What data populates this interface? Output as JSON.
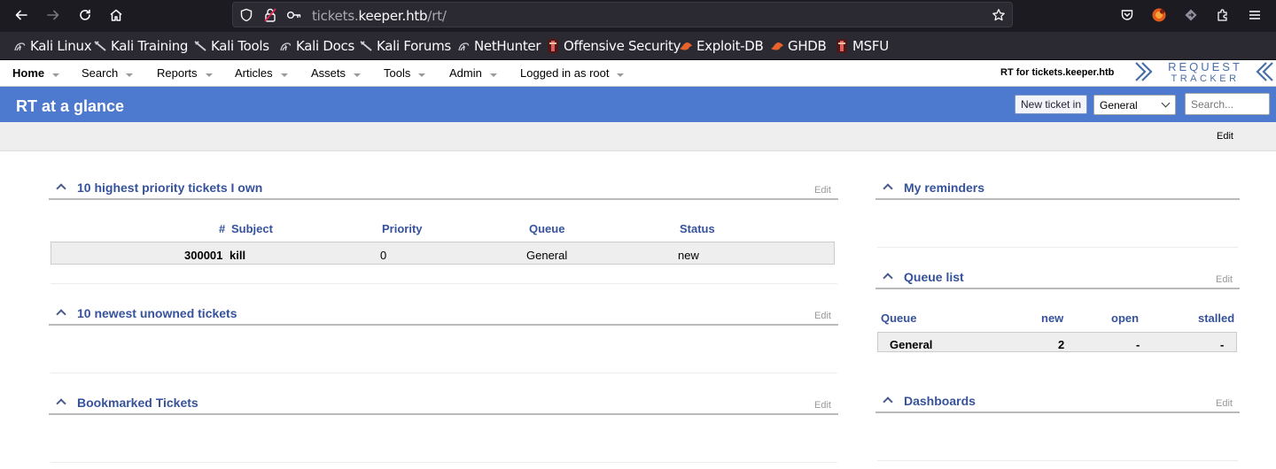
{
  "browser": {
    "url_prefix": "tickets.",
    "url_host": "keeper.htb",
    "url_path": "/rt/"
  },
  "bookmarks": [
    {
      "label": "Kali Linux",
      "icon": "kali-dragon-icon"
    },
    {
      "label": "Kali Training",
      "icon": "kali-sword-icon"
    },
    {
      "label": "Kali Tools",
      "icon": "kali-sword-icon"
    },
    {
      "label": "Kali Docs",
      "icon": "kali-dragon-icon"
    },
    {
      "label": "Kali Forums",
      "icon": "kali-sword-icon"
    },
    {
      "label": "NetHunter",
      "icon": "kali-dragon-icon"
    },
    {
      "label": "Offensive Security",
      "icon": "offsec-icon"
    },
    {
      "label": "Exploit-DB",
      "icon": "exploitdb-icon"
    },
    {
      "label": "GHDB",
      "icon": "exploitdb-icon"
    },
    {
      "label": "MSFU",
      "icon": "offsec-icon"
    }
  ],
  "menu": {
    "items": [
      "Home",
      "Search",
      "Reports",
      "Articles",
      "Assets",
      "Tools",
      "Admin",
      "Logged in as root"
    ],
    "rt_for": "RT for tickets.keeper.htb",
    "logo_line1": "REQUEST",
    "logo_line2": "TRACKER"
  },
  "header": {
    "title": "RT at a glance",
    "new_ticket_label": "New ticket in",
    "queue_selected": "General",
    "search_placeholder": "Search..."
  },
  "subbar": {
    "edit_label": "Edit"
  },
  "portlets": {
    "highest_priority": {
      "title": "10 highest priority tickets I own",
      "edit": "Edit",
      "columns": {
        "id": "#",
        "subject": "Subject",
        "priority": "Priority",
        "queue": "Queue",
        "status": "Status"
      },
      "rows": [
        {
          "id": "300001",
          "subject": "kill",
          "priority": "0",
          "queue": "General",
          "status": "new"
        }
      ]
    },
    "newest_unowned": {
      "title": "10 newest unowned tickets",
      "edit": "Edit"
    },
    "bookmarked": {
      "title": "Bookmarked Tickets",
      "edit": "Edit"
    },
    "reminders": {
      "title": "My reminders"
    },
    "queue_list": {
      "title": "Queue list",
      "edit": "Edit",
      "columns": {
        "queue": "Queue",
        "new": "new",
        "open": "open",
        "stalled": "stalled"
      },
      "rows": [
        {
          "queue": "General",
          "new": "2",
          "open": "-",
          "stalled": "-"
        }
      ]
    },
    "dashboards": {
      "title": "Dashboards",
      "edit": "Edit"
    }
  },
  "colors": {
    "title_bar": "#4d7ace",
    "link": "#36529c",
    "chrome_dark": "#1c1b22"
  }
}
